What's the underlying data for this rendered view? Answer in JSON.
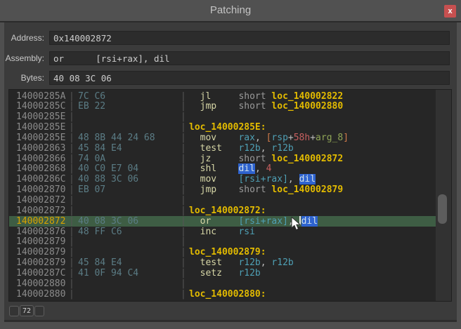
{
  "window": {
    "title": "Patching",
    "close_label": "x"
  },
  "form": {
    "address_label": "Address:",
    "address_value": "0x140002872",
    "assembly_label": "Assembly:",
    "assembly_value": "or      [rsi+rax], dil",
    "bytes_label": "Bytes:",
    "bytes_value": "40 08 3C 06"
  },
  "footer": {
    "counter": "72"
  },
  "colors": {
    "titlebar": "#515151",
    "panel": "#3b3b3b",
    "listing_bg": "#262626",
    "close_red": "#c75050",
    "highlight_green": "#3e5d44",
    "selection_blue": "#2e63cf",
    "label_yellow": "#e3bb00",
    "register_teal": "#4fa0b5",
    "number_red": "#c75f5f",
    "mnemonic_yellow": "#d6d6a6",
    "address_gray": "#8b8b8b",
    "bytes_teal": "#5b7c85",
    "highlight_address_yellow": "#d9a300",
    "stackvar_green": "#8fa456"
  },
  "listing": {
    "rows": [
      {
        "addr": "14000285A",
        "bytes": "7C C6",
        "d": [
          {
            "c": "mnem",
            "t": "  jl     "
          },
          {
            "c": "kw",
            "t": "short "
          },
          {
            "c": "target",
            "t": "loc_140002822"
          }
        ]
      },
      {
        "addr": "14000285C",
        "bytes": "EB 22",
        "d": [
          {
            "c": "mnem",
            "t": "  jmp    "
          },
          {
            "c": "kw",
            "t": "short "
          },
          {
            "c": "target",
            "t": "loc_140002880"
          }
        ]
      },
      {
        "addr": "14000285E",
        "bytes": "",
        "d": []
      },
      {
        "addr": "14000285E",
        "bytes": "",
        "d": [
          {
            "c": "label",
            "t": "loc_14000285E:"
          }
        ]
      },
      {
        "addr": "14000285E",
        "bytes": "48 8B 44 24 68",
        "d": [
          {
            "c": "mnem",
            "t": "  mov    "
          },
          {
            "c": "reg",
            "t": "rax"
          },
          {
            "c": "punct",
            "t": ", "
          },
          {
            "c": "obr",
            "t": "["
          },
          {
            "c": "reg",
            "t": "rsp"
          },
          {
            "c": "punct",
            "t": "+"
          },
          {
            "c": "num",
            "t": "58h"
          },
          {
            "c": "punct",
            "t": "+"
          },
          {
            "c": "svar",
            "t": "arg_8"
          },
          {
            "c": "obr",
            "t": "]"
          }
        ]
      },
      {
        "addr": "140002863",
        "bytes": "45 84 E4",
        "d": [
          {
            "c": "mnem",
            "t": "  test   "
          },
          {
            "c": "reg",
            "t": "r12b"
          },
          {
            "c": "punct",
            "t": ", "
          },
          {
            "c": "reg",
            "t": "r12b"
          }
        ]
      },
      {
        "addr": "140002866",
        "bytes": "74 0A",
        "d": [
          {
            "c": "mnem",
            "t": "  jz     "
          },
          {
            "c": "kw",
            "t": "short "
          },
          {
            "c": "target",
            "t": "loc_140002872"
          }
        ]
      },
      {
        "addr": "140002868",
        "bytes": "40 C0 E7 04",
        "d": [
          {
            "c": "mnem",
            "t": "  shl    "
          },
          {
            "c": "sel",
            "t": "dil"
          },
          {
            "c": "punct",
            "t": ", "
          },
          {
            "c": "num",
            "t": "4"
          }
        ]
      },
      {
        "addr": "14000286C",
        "bytes": "40 88 3C 06",
        "d": [
          {
            "c": "mnem",
            "t": "  mov    "
          },
          {
            "c": "reg",
            "t": "[rsi+rax]"
          },
          {
            "c": "punct",
            "t": ", "
          },
          {
            "c": "sel",
            "t": "dil"
          }
        ]
      },
      {
        "addr": "140002870",
        "bytes": "EB 07",
        "d": [
          {
            "c": "mnem",
            "t": "  jmp    "
          },
          {
            "c": "kw",
            "t": "short "
          },
          {
            "c": "target",
            "t": "loc_140002879"
          }
        ]
      },
      {
        "addr": "140002872",
        "bytes": "",
        "d": []
      },
      {
        "addr": "140002872",
        "bytes": "",
        "d": [
          {
            "c": "label",
            "t": "loc_140002872:"
          }
        ]
      },
      {
        "addr": "140002872",
        "bytes": "40 08 3C 06",
        "hl": true,
        "d": [
          {
            "c": "mnem",
            "t": "  or     "
          },
          {
            "c": "reg",
            "t": "[rsi+rax]"
          },
          {
            "c": "punct",
            "t": ", "
          },
          {
            "c": "caret",
            "t": ""
          },
          {
            "c": "sel",
            "t": "dil"
          }
        ]
      },
      {
        "addr": "140002876",
        "bytes": "48 FF C6",
        "d": [
          {
            "c": "mnem",
            "t": "  inc    "
          },
          {
            "c": "reg",
            "t": "rsi"
          }
        ]
      },
      {
        "addr": "140002879",
        "bytes": "",
        "d": []
      },
      {
        "addr": "140002879",
        "bytes": "",
        "d": [
          {
            "c": "label",
            "t": "loc_140002879:"
          }
        ]
      },
      {
        "addr": "140002879",
        "bytes": "45 84 E4",
        "d": [
          {
            "c": "mnem",
            "t": "  test   "
          },
          {
            "c": "reg",
            "t": "r12b"
          },
          {
            "c": "punct",
            "t": ", "
          },
          {
            "c": "reg",
            "t": "r12b"
          }
        ]
      },
      {
        "addr": "14000287C",
        "bytes": "41 0F 94 C4",
        "d": [
          {
            "c": "mnem",
            "t": "  setz   "
          },
          {
            "c": "reg",
            "t": "r12b"
          }
        ]
      },
      {
        "addr": "140002880",
        "bytes": "",
        "d": []
      },
      {
        "addr": "140002880",
        "bytes": "",
        "d": [
          {
            "c": "label",
            "t": "loc_140002880:"
          }
        ]
      }
    ]
  }
}
